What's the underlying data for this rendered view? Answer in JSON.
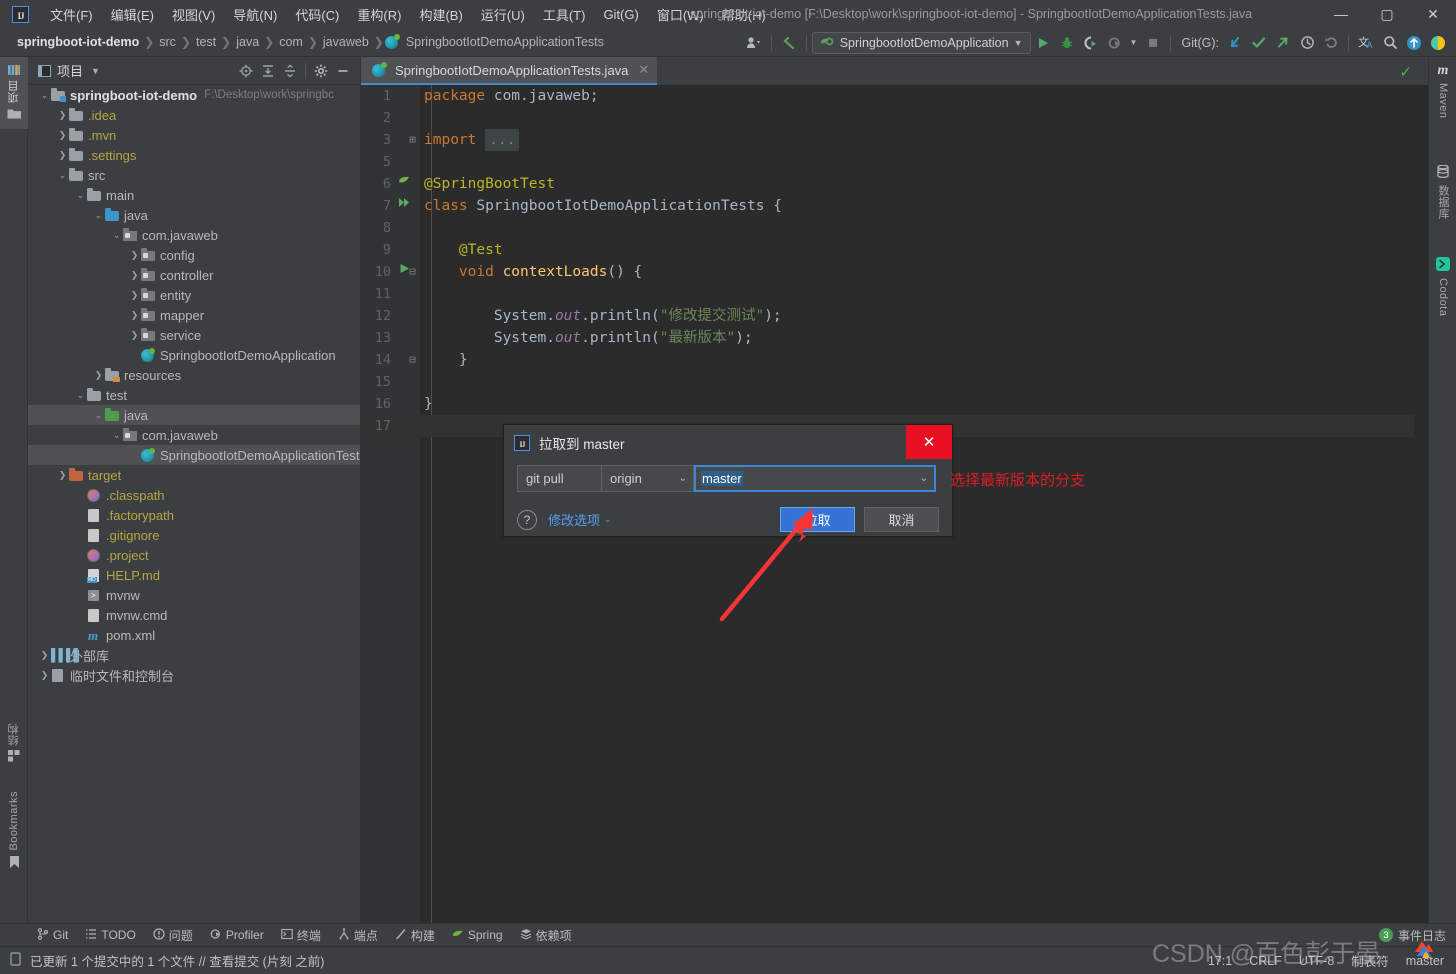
{
  "window": {
    "title": "springboot-iot-demo [F:\\Desktop\\work\\springboot-iot-demo] - SpringbootIotDemoApplicationTests.java",
    "minimize": "—",
    "maximize": "▢",
    "close": "✕"
  },
  "menubar": {
    "logo": "IJ",
    "items": [
      {
        "label": "文件(F)"
      },
      {
        "label": "编辑(E)"
      },
      {
        "label": "视图(V)"
      },
      {
        "label": "导航(N)"
      },
      {
        "label": "代码(C)"
      },
      {
        "label": "重构(R)"
      },
      {
        "label": "构建(B)"
      },
      {
        "label": "运行(U)"
      },
      {
        "label": "工具(T)"
      },
      {
        "label": "Git(G)"
      },
      {
        "label": "窗口(W)"
      },
      {
        "label": "帮助(H)"
      }
    ]
  },
  "navbar": {
    "crumbs": [
      "springboot-iot-demo",
      "src",
      "test",
      "java",
      "com",
      "javaweb",
      "SpringbootIotDemoApplicationTests"
    ],
    "separator": "❯",
    "run_config": "SpringbootIotDemoApplication",
    "git_label": "Git(G):",
    "icons": {
      "profile": "profile-icon",
      "back": "back-arrow-icon",
      "run": "▶",
      "debug": "debug-icon",
      "coverage": "coverage-icon",
      "profiler": "profiler-icon",
      "stop": "■",
      "update": "↙",
      "commit": "✓",
      "push": "↗",
      "history": "🕐",
      "rollback": "↺",
      "translate": "文A",
      "search": "🔍",
      "upload": "↑",
      "codota": "codota-icon"
    }
  },
  "left_strip": {
    "structure": "结构",
    "bookmarks": "Bookmarks"
  },
  "right_strip": {
    "maven": "Maven",
    "database": "数据库",
    "codota": "Codota"
  },
  "project_panel": {
    "title": "项目",
    "tools": [
      "locate-icon",
      "expand-all-icon",
      "collapse-all-icon",
      "settings-icon",
      "hide-icon"
    ],
    "tree": [
      {
        "depth": 0,
        "arrow": "v",
        "icon": "module",
        "label": "springboot-iot-demo",
        "bold": true,
        "path": "F:\\Desktop\\work\\springbc",
        "color": "#e0e0e0"
      },
      {
        "depth": 1,
        "arrow": ">",
        "icon": "folder",
        "label": ".idea",
        "color": "#b5a642"
      },
      {
        "depth": 1,
        "arrow": ">",
        "icon": "folder",
        "label": ".mvn",
        "color": "#b5a642"
      },
      {
        "depth": 1,
        "arrow": ">",
        "icon": "folder",
        "label": ".settings",
        "color": "#b5a642"
      },
      {
        "depth": 1,
        "arrow": "v",
        "icon": "folder",
        "label": "src",
        "color": "#b8b8b8"
      },
      {
        "depth": 2,
        "arrow": "v",
        "icon": "folder",
        "label": "main",
        "color": "#b8b8b8"
      },
      {
        "depth": 3,
        "arrow": "v",
        "icon": "folder-src",
        "label": "java",
        "color": "#b8b8b8"
      },
      {
        "depth": 4,
        "arrow": "v",
        "icon": "package",
        "label": "com.javaweb",
        "color": "#b8b8b8"
      },
      {
        "depth": 5,
        "arrow": ">",
        "icon": "package",
        "label": "config",
        "color": "#b8b8b8"
      },
      {
        "depth": 5,
        "arrow": ">",
        "icon": "package",
        "label": "controller",
        "color": "#b8b8b8"
      },
      {
        "depth": 5,
        "arrow": ">",
        "icon": "package",
        "label": "entity",
        "color": "#b8b8b8"
      },
      {
        "depth": 5,
        "arrow": ">",
        "icon": "package",
        "label": "mapper",
        "color": "#b8b8b8"
      },
      {
        "depth": 5,
        "arrow": ">",
        "icon": "package",
        "label": "service",
        "color": "#b8b8b8"
      },
      {
        "depth": 5,
        "arrow": "",
        "icon": "class-spring",
        "label": "SpringbootIotDemoApplication",
        "color": "#b8b8b8"
      },
      {
        "depth": 3,
        "arrow": ">",
        "icon": "folder-res",
        "label": "resources",
        "color": "#b8b8b8"
      },
      {
        "depth": 2,
        "arrow": "v",
        "icon": "folder",
        "label": "test",
        "color": "#b8b8b8"
      },
      {
        "depth": 3,
        "arrow": "v",
        "icon": "folder-test",
        "label": "java",
        "color": "#b8b8b8",
        "selected_row": true
      },
      {
        "depth": 4,
        "arrow": "v",
        "icon": "package",
        "label": "com.javaweb",
        "color": "#b8b8b8"
      },
      {
        "depth": 5,
        "arrow": "",
        "icon": "class-spring",
        "label": "SpringbootIotDemoApplicationTests",
        "color": "#b8b8b8",
        "selected": true
      },
      {
        "depth": 1,
        "arrow": ">",
        "icon": "folder-target",
        "label": "target",
        "color": "#b5a642"
      },
      {
        "depth": 2,
        "arrow": "",
        "icon": "ring",
        "label": ".classpath",
        "color": "#b5a642"
      },
      {
        "depth": 2,
        "arrow": "",
        "icon": "file",
        "label": ".factorypath",
        "color": "#b5a642"
      },
      {
        "depth": 2,
        "arrow": "",
        "icon": "file-git",
        "label": ".gitignore",
        "color": "#b5a642"
      },
      {
        "depth": 2,
        "arrow": "",
        "icon": "ring",
        "label": ".project",
        "color": "#b5a642"
      },
      {
        "depth": 2,
        "arrow": "",
        "icon": "md",
        "label": "HELP.md",
        "color": "#b5a642"
      },
      {
        "depth": 2,
        "arrow": "",
        "icon": "sh",
        "label": "mvnw",
        "color": "#b8b8b8"
      },
      {
        "depth": 2,
        "arrow": "",
        "icon": "file",
        "label": "mvnw.cmd",
        "color": "#b8b8b8"
      },
      {
        "depth": 2,
        "arrow": "",
        "icon": "maven",
        "label": "pom.xml",
        "color": "#b8b8b8"
      },
      {
        "depth": 0,
        "arrow": ">",
        "icon": "lib",
        "label": "外部库",
        "color": "#b8b8b8"
      },
      {
        "depth": 0,
        "arrow": ">",
        "icon": "scratch",
        "label": "临时文件和控制台",
        "color": "#b8b8b8"
      }
    ]
  },
  "editor": {
    "tab": {
      "label": "SpringbootIotDemoApplicationTests.java",
      "close": "✕"
    },
    "lines": [
      {
        "num": "1",
        "segments": [
          {
            "t": "package",
            "c": "k"
          },
          {
            "t": " com.javaweb;",
            "c": "typ"
          }
        ]
      },
      {
        "num": "2",
        "segments": []
      },
      {
        "num": "3",
        "fold": "⊞",
        "segments": [
          {
            "t": "import",
            "c": "k"
          },
          {
            "t": " ",
            "c": "typ"
          },
          {
            "t": "...",
            "c": "foldbox"
          }
        ]
      },
      {
        "num": "5",
        "segments": []
      },
      {
        "num": "6",
        "gutter": "spring-leaf-icon",
        "segments": [
          {
            "t": "@SpringBootTest",
            "c": "ann"
          }
        ]
      },
      {
        "num": "7",
        "gutter": "run-test-class-icon",
        "segments": [
          {
            "t": "class",
            "c": "k"
          },
          {
            "t": " SpringbootIotDemoApplicationTests ",
            "c": "typ"
          },
          {
            "t": "{",
            "c": "brace"
          }
        ]
      },
      {
        "num": "8",
        "segments": []
      },
      {
        "num": "9",
        "segments": [
          {
            "t": "    @Test",
            "c": "ann"
          }
        ]
      },
      {
        "num": "10",
        "gutter": "run-test-method-icon",
        "fold": "⊟",
        "segments": [
          {
            "t": "    ",
            "c": "typ"
          },
          {
            "t": "void",
            "c": "k"
          },
          {
            "t": " ",
            "c": "typ"
          },
          {
            "t": "contextLoads",
            "c": "mth"
          },
          {
            "t": "() {",
            "c": "brace"
          }
        ]
      },
      {
        "num": "11",
        "segments": []
      },
      {
        "num": "12",
        "segments": [
          {
            "t": "        System.",
            "c": "typ"
          },
          {
            "t": "out",
            "c": "fld"
          },
          {
            "t": ".println(",
            "c": "typ"
          },
          {
            "t": "\"修改提交测试\"",
            "c": "str"
          },
          {
            "t": ");",
            "c": "typ"
          }
        ]
      },
      {
        "num": "13",
        "segments": [
          {
            "t": "        System.",
            "c": "typ"
          },
          {
            "t": "out",
            "c": "fld"
          },
          {
            "t": ".println(",
            "c": "typ"
          },
          {
            "t": "\"最新版本\"",
            "c": "str"
          },
          {
            "t": ");",
            "c": "typ"
          }
        ]
      },
      {
        "num": "14",
        "fold": "⊟",
        "segments": [
          {
            "t": "    }",
            "c": "brace"
          }
        ]
      },
      {
        "num": "15",
        "segments": []
      },
      {
        "num": "16",
        "segments": [
          {
            "t": "}",
            "c": "brace"
          }
        ]
      },
      {
        "num": "17",
        "segments": [],
        "highlight": true
      }
    ],
    "inspection_status": "✓"
  },
  "dialog": {
    "title": "拉取到 master",
    "logo": "IJ",
    "close": "✕",
    "command": "git pull",
    "remote": "origin",
    "remote_caret": "⌄",
    "branch_value": "master",
    "branch_caret": "⌄",
    "help": "?",
    "modify_options": "修改选项",
    "modify_caret": "⌄",
    "pull_button": "拉取",
    "cancel_button": "取消"
  },
  "annotation": {
    "text": "选择最新版本的分支",
    "color": "#e01b24"
  },
  "bottom_toolwindows": [
    {
      "icon": "git-branch-icon",
      "label": "Git"
    },
    {
      "icon": "todo-list-icon",
      "label": "TODO"
    },
    {
      "icon": "problems-icon",
      "label": "问题"
    },
    {
      "icon": "profiler-icon",
      "label": "Profiler"
    },
    {
      "icon": "terminal-icon",
      "label": "终端"
    },
    {
      "icon": "endpoints-icon",
      "label": "端点"
    },
    {
      "icon": "build-icon",
      "label": "构建"
    },
    {
      "icon": "spring-icon",
      "label": "Spring"
    },
    {
      "icon": "dependencies-icon",
      "label": "依赖项"
    }
  ],
  "event_log": {
    "count": "3",
    "label": "事件日志"
  },
  "statusbar": {
    "message": "已更新 1 个提交中的 1 个文件 // 查看提交 (片刻 之前)",
    "position": "17:1",
    "line_sep": "CRLF",
    "encoding": "UTF-8",
    "indent": "制表符",
    "branch": "master"
  },
  "watermark": {
    "text": "CSDN @百色彭于晏"
  }
}
